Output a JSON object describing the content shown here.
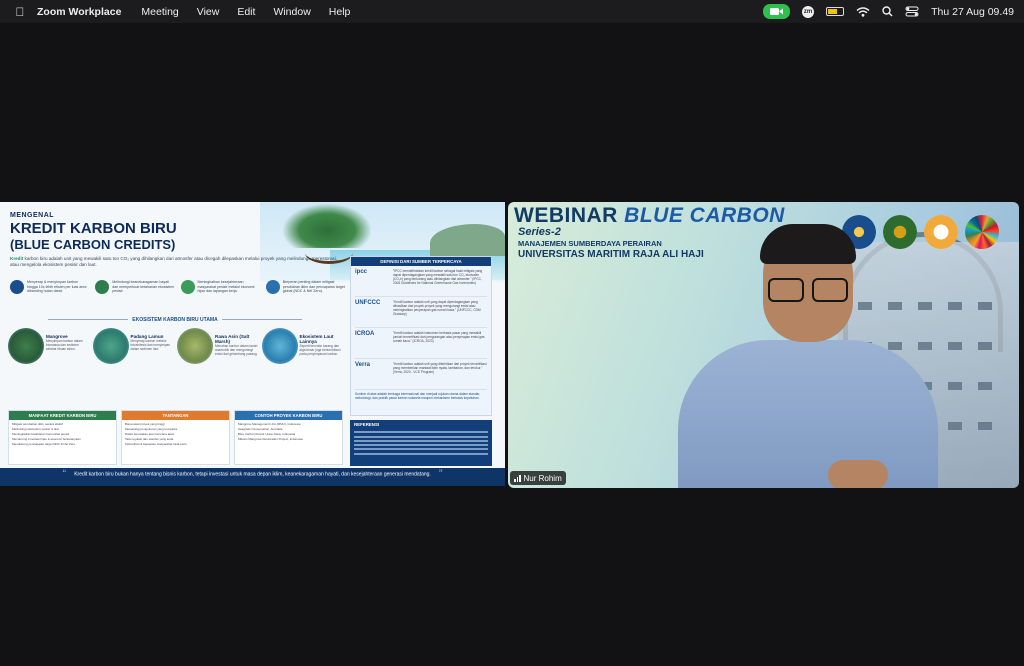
{
  "menubar": {
    "apple_label": "",
    "app_name": "Zoom Workplace",
    "items": [
      "Meeting",
      "View",
      "Edit",
      "Window",
      "Help"
    ],
    "clock": "Thu 27 Aug  09.49",
    "battery_level": 0.6,
    "colors": {
      "camera_pill": "#2fbf4f"
    }
  },
  "slide": {
    "pre_title": "MENGENAL",
    "title": "KREDIT  KARBON BIRU",
    "subtitle": "(BLUE CARBON CREDITS)",
    "desc_highlight": "Kredit",
    "description": " karbon biru adalah unit yang mewakili satu ton CO₂ yang dihilangkan dari atmosfer atau dicegah dilepaskan melalui proyek yang melindungi, merestorasi, atau mengelola ekosistem pesisir dan laut.",
    "benefits": [
      "Menyerap & menyimpan karbon hingga 10x lebih efisien per luas area dibanding hutan darat.",
      "Melindungi keanekaragaman hayati dan memperkuat ketahanan ekosistem pesisir.",
      "Meningkatkan kesejahteraan masyarakat pesisir melalui ekonomi hijau dan lapangan kerja.",
      "Berperan penting dalam mitigasi perubahan iklim dan pencapaian target global (NDC & Net Zero)."
    ],
    "eco_title": "EKOSISTEM KARBON BIRU UTAMA",
    "ecosystems": [
      {
        "name": "Mangrove",
        "desc": "Menyimpan karbon dalam biomassa dan sedimen selama ribuan tahun."
      },
      {
        "name": "Padang Lamun",
        "desc": "Menyerap karbon melalui fotosintesis dan menyimpan dalam sedimen laut."
      },
      {
        "name": "Rawa Asin (Salt Marsh)",
        "desc": "Menahan karbon dalam tanah anaerobik dan mengurangi emisi dari gelombang pasang."
      },
      {
        "name": "Ekosistem Laut Lainnya",
        "desc": "Seperti terumbu karang dan alga besar juga berkontribusi pada penyimpanan karbon."
      }
    ],
    "def_title": "DEFINISI DARI SUMBER TERPERCAYA",
    "definitions": [
      {
        "org": "ipcc",
        "text": "\"IPCC mendefinisikan kredit karbon sebagai hasil mitigasi yang dapat diperdagangkan yang mewakili satu ton CO₂ ekuivalen (CO₂e) yang berkurang atau dihilangkan dari atmosfer.\" (IPCC, 2006 Guidelines for National Greenhouse Gas Inventories)"
      },
      {
        "org": "UNFCCC",
        "text": "\"Kredit karbon adalah unit yang dapat diperdagangkan yang dihasilkan dari proyek-proyek yang mengurangi emisi atau meningkatkan penyerapan gas rumah kaca.\" (UNFCCC, CDM Glossary)"
      },
      {
        "org": "ICROA",
        "text": "\"Kredit karbon adalah instrumen berbasis pasar yang mewakili jumlah terverifikasi dari pengurangan atau penyerapan emisi gas rumah kaca.\" (ICROA, 2023)"
      },
      {
        "org": "Verra",
        "text": "\"Kredit karbon adalah unit yang diterbitkan dari proyek terverifikasi yang memberikan manfaat iklim nyata, tambahan, dan terukur.\" (Verra, 2023 - VCS Program)"
      }
    ],
    "def_footer": "Sumber di atas adalah lembaga internasional dan menjadi rujukan utama dalam standar, metodologi, dan praktik pasar karbon sukarela maupun mekanisme berbasis kepatuhan.",
    "panels": [
      {
        "title": "MANFAAT KREDIT KARBON BIRU",
        "color": "#2e7d4f",
        "items": [
          "Mitigasi perubahan iklim secara efektif",
          "Melindungi ekosistem pesisir & laut",
          "Meningkatkan ketahanan komunitas pesisir",
          "Mendorong investasi hijau & ekonomi berkelanjutan",
          "Mendukung pencapaian target NDC & Net Zero"
        ]
      },
      {
        "title": "TANTANGAN",
        "color": "#e07a2d",
        "items": [
          "Biaya awal proyek yang tinggi",
          "Metodologi pengukuran yang kompleks",
          "Risiko kerusakan atau bencana alam",
          "Tata regulasi dan standar yang ketat",
          "Kebutuhan & kapasitas masyarakat lokal perlu"
        ]
      },
      {
        "title": "CONTOH PROYEK KARBON BIRU",
        "color": "#2a6fb0",
        "items": [
          "Mangrove Management Unit (MMU), Indonesia",
          "Seagrass Conservation, Australia",
          "Blue Carbon Pesisir Utara Jawa, Indonesia",
          "Mikoko Mangrove Restoration Project, Indonesia"
        ]
      }
    ],
    "ref_title": "REFERENSI",
    "quote": "Kredit karbon biru bukan hanya tentang bisnis karbon, tetapi investasi untuk masa depan iklim, keanekaragaman hayati, dan kesejahteraan generasi mendatang.",
    "quote_open": "“",
    "quote_close": "”"
  },
  "video": {
    "title_a": "WEBINAR ",
    "title_b": "BLUE CARBON",
    "series": "Series-2",
    "mgmt": "MANAJEMEN SUMBERDAYA PERAIRAN",
    "univ": "UNIVERSITAS MARITIM RAJA ALI HAJI",
    "participant_name": "Nur Rohim"
  }
}
